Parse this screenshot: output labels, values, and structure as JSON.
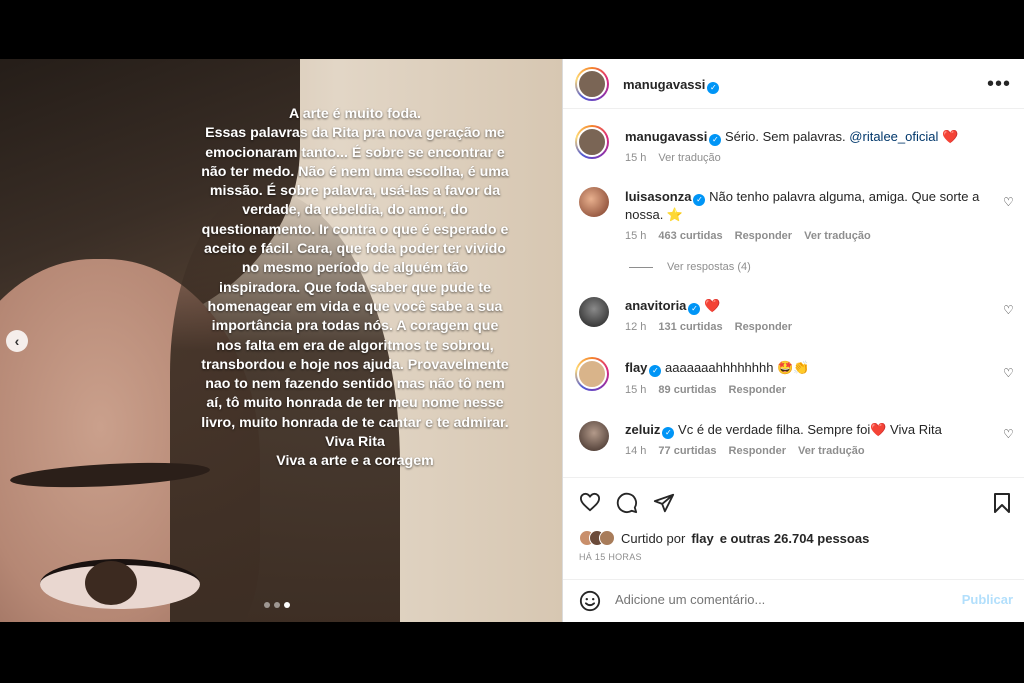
{
  "story": {
    "text": "A arte é muito foda.\nEssas palavras da Rita pra nova geração me emocionaram tanto... É sobre se encontrar e não ter medo. Não é nem uma escolha, é uma missão. É sobre palavra, usá-las a favor da verdade, da rebeldia, do amor, do questionamento. Ir contra o que é esperado e aceito e fácil. Cara, que foda poder ter vivido no mesmo período de alguém tão inspiradora. Que foda saber que pude te homenagear em vida e que você sabe a sua importância pra todas nós. A coragem que nos falta em era de algoritmos te sobrou, transbordou e hoje nos ajuda. Provavelmente nao to nem fazendo sentido mas não tô nem aí, tô muito honrada de ter meu nome nesse livro, muito honrada de te cantar e te admirar.\nViva Rita\nViva a arte e a coragem",
    "prev_arrow": "‹"
  },
  "header": {
    "username": "manugavassi",
    "more": "•••"
  },
  "caption": {
    "username": "manugavassi",
    "text": "Sério. Sem palavras.",
    "mention": "@ritalee_oficial",
    "emoji": "❤️",
    "time": "15 h",
    "translate": "Ver tradução"
  },
  "comments": [
    {
      "username": "luisasonza",
      "text": "Não tenho palavra alguma, amiga. Que sorte a nossa. ⭐",
      "time": "15 h",
      "likes": "463 curtidas",
      "reply": "Responder",
      "translate": "Ver tradução",
      "verified": true
    },
    {
      "username": "anavitoria",
      "text": "❤️",
      "time": "12 h",
      "likes": "131 curtidas",
      "reply": "Responder",
      "translate": "",
      "verified": true
    },
    {
      "username": "flay",
      "text": "aaaaaaahhhhhhhh 🤩👏",
      "time": "15 h",
      "likes": "89 curtidas",
      "reply": "Responder",
      "translate": "",
      "verified": true
    },
    {
      "username": "zeluiz",
      "text": "Vc é de verdade filha. Sempre foi❤️ Viva Rita",
      "time": "14 h",
      "likes": "77 curtidas",
      "reply": "Responder",
      "translate": "Ver tradução",
      "verified": true
    }
  ],
  "replies_label": "Ver respostas (4)",
  "liked_by": {
    "prefix": "Curtido por",
    "user": "flay",
    "rest": "e outras 26.704 pessoas"
  },
  "time_ago": "HÁ 15 HORAS",
  "add_comment": {
    "placeholder": "Adicione um comentário...",
    "publish": "Publicar"
  },
  "colors": {
    "accent": "#0095f6",
    "publish_disabled": "#b2dffc"
  }
}
